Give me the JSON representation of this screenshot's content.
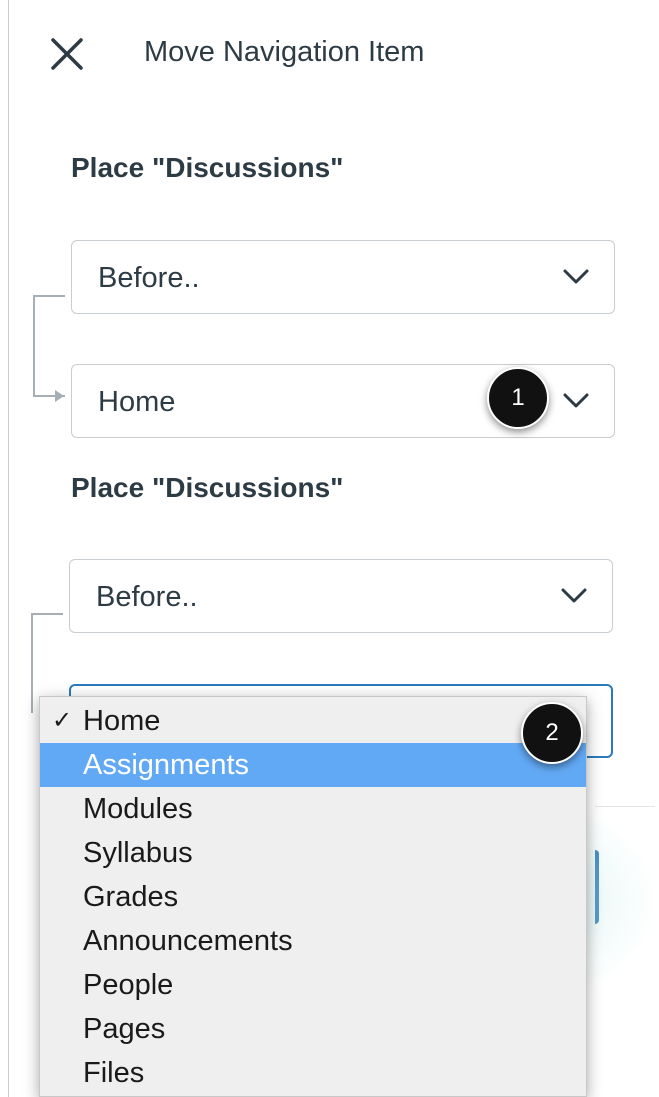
{
  "header": {
    "title": "Move Navigation Item",
    "close_icon": "close-icon"
  },
  "section1": {
    "label": "Place \"Discussions\"",
    "position_select": {
      "value": "Before.."
    },
    "target_select": {
      "value": "Home"
    },
    "callout": "1"
  },
  "section2": {
    "label": "Place \"Discussions\"",
    "position_select": {
      "value": "Before.."
    },
    "callout": "2",
    "dropdown": {
      "selected": "Home",
      "check_mark": "✓",
      "highlighted": "Assignments",
      "options": [
        "Home",
        "Assignments",
        "Modules",
        "Syllabus",
        "Grades",
        "Announcements",
        "People",
        "Pages",
        "Files"
      ]
    }
  },
  "colors": {
    "highlight": "#62a9f5",
    "focus_border": "#2b7abc",
    "text": "#2d3b45"
  }
}
